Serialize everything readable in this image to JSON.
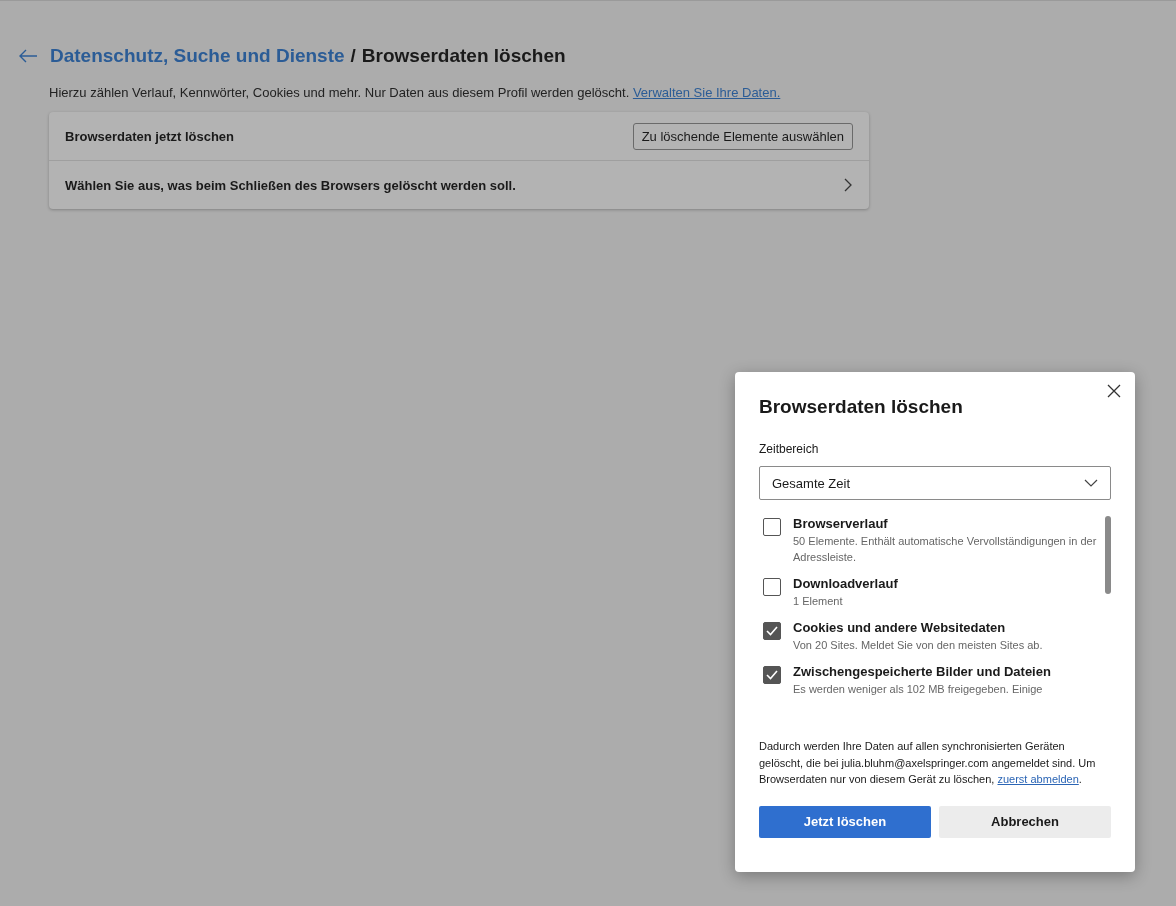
{
  "header": {
    "parent": "Datenschutz, Suche und Dienste",
    "separator": "/",
    "title": "Browserdaten löschen"
  },
  "description": {
    "text": "Hierzu zählen Verlauf, Kennwörter, Cookies und mehr. Nur Daten aus diesem Profil werden gelöscht.",
    "link": "Verwalten Sie Ihre Daten."
  },
  "card": {
    "rows": [
      {
        "kind": "button",
        "label": "Browserdaten jetzt löschen",
        "button": "Zu löschende Elemente auswählen"
      },
      {
        "kind": "chevron",
        "label": "Wählen Sie aus, was beim Schließen des Browsers gelöscht werden soll."
      }
    ]
  },
  "dialog": {
    "title": "Browserdaten löschen",
    "range_label": "Zeitbereich",
    "range_value": "Gesamte Zeit",
    "items": [
      {
        "label": "Browserverlauf",
        "detail": "50 Elemente. Enthält automatische Vervollständigungen in der Adressleiste.",
        "checked": false
      },
      {
        "label": "Downloadverlauf",
        "detail": "1 Element",
        "checked": false
      },
      {
        "label": "Cookies und andere Websitedaten",
        "detail": "Von 20 Sites. Meldet Sie von den meisten Sites ab.",
        "checked": true
      },
      {
        "label": "Zwischengespeicherte Bilder und Dateien",
        "detail": "Es werden weniger als 102 MB freigegeben. Einige",
        "checked": true
      }
    ],
    "notice": {
      "text": "Dadurch werden Ihre Daten auf allen synchronisierten Geräten gelöscht, die bei julia.bluhm@axelspringer.com angemeldet sind. Um Browserdaten nur von diesem Gerät zu löschen,",
      "link": "zuerst abmelden",
      "end": "."
    },
    "buttons": [
      {
        "label": "Jetzt löschen",
        "kind": "primary"
      },
      {
        "label": "Abbrechen",
        "kind": "secondary"
      }
    ]
  }
}
